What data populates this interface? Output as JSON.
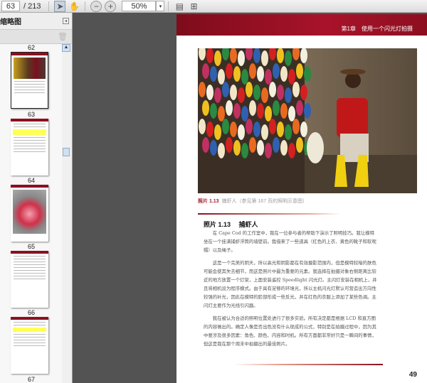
{
  "toolbar": {
    "current_page": "63",
    "total_pages": "/ 213",
    "zoom": "50%",
    "icons": [
      "select-tool-icon",
      "hand-tool-icon",
      "zoom-out-icon",
      "zoom-in-icon",
      "fit-page-icon",
      "fit-width-icon"
    ]
  },
  "sidebar": {
    "title": "缩略图",
    "thumbnails": [
      {
        "label": "62"
      },
      {
        "label": "63"
      },
      {
        "label": "64"
      },
      {
        "label": "65"
      },
      {
        "label": "66"
      },
      {
        "label": "67"
      }
    ]
  },
  "page": {
    "header": "第1章　使用一个闪光灯拍摄",
    "caption_label": "照片 1.13",
    "caption_text": "捕虾人（参见第 167 页的照明示意图）",
    "heading": "照片 1.13　 捕虾人",
    "paragraphs": [
      "在 Cape Cod 的工作室中，我在一位参与者的帮助下演示了照明技巧。我让模特坐在一个挂满捕虾浮筒的墙壁前。我借来了一些道具（红色的上衣、黄色的靴子和软呢帽）以及绳子。",
      "这是一个完美的阴天，所以高光和阴影都在有效摄影范围内，但是模特较暗的肤色可能会使其失去细节，而这是照片中最为重要的元素。我选择在拍摄对象右侧距离比较近的地方放置一个灯架，上面安装遥控 Speedlight 闪光灯。主闪灯安装在相机上，并且将相机设为程序模式。由于具有足够的环境光，所以主机闪光灯默认可营造出方向性较强的补光，因此在模特的脸部形成一些反光，并在红色的衣服上添加了某些色调。主闪灯主要作为光线引闪器。",
      "我在被认为合适的照明位置处进行了很多实验。所有决定都是根据 LCD 和直方图的内容做出的。确定人像是否出色没有什么现成的公式，特别是在拍摄过程中，因为其中要涉及很多因素：角色、颜色、内容和时机。所有方面都非常好只是一瞬间的事情，但这是我在那个周末中拍摄出的最佳照片。"
    ],
    "page_number": "49"
  },
  "colors": {
    "accent": "#a41c2c",
    "viewer_bg": "#535353"
  }
}
